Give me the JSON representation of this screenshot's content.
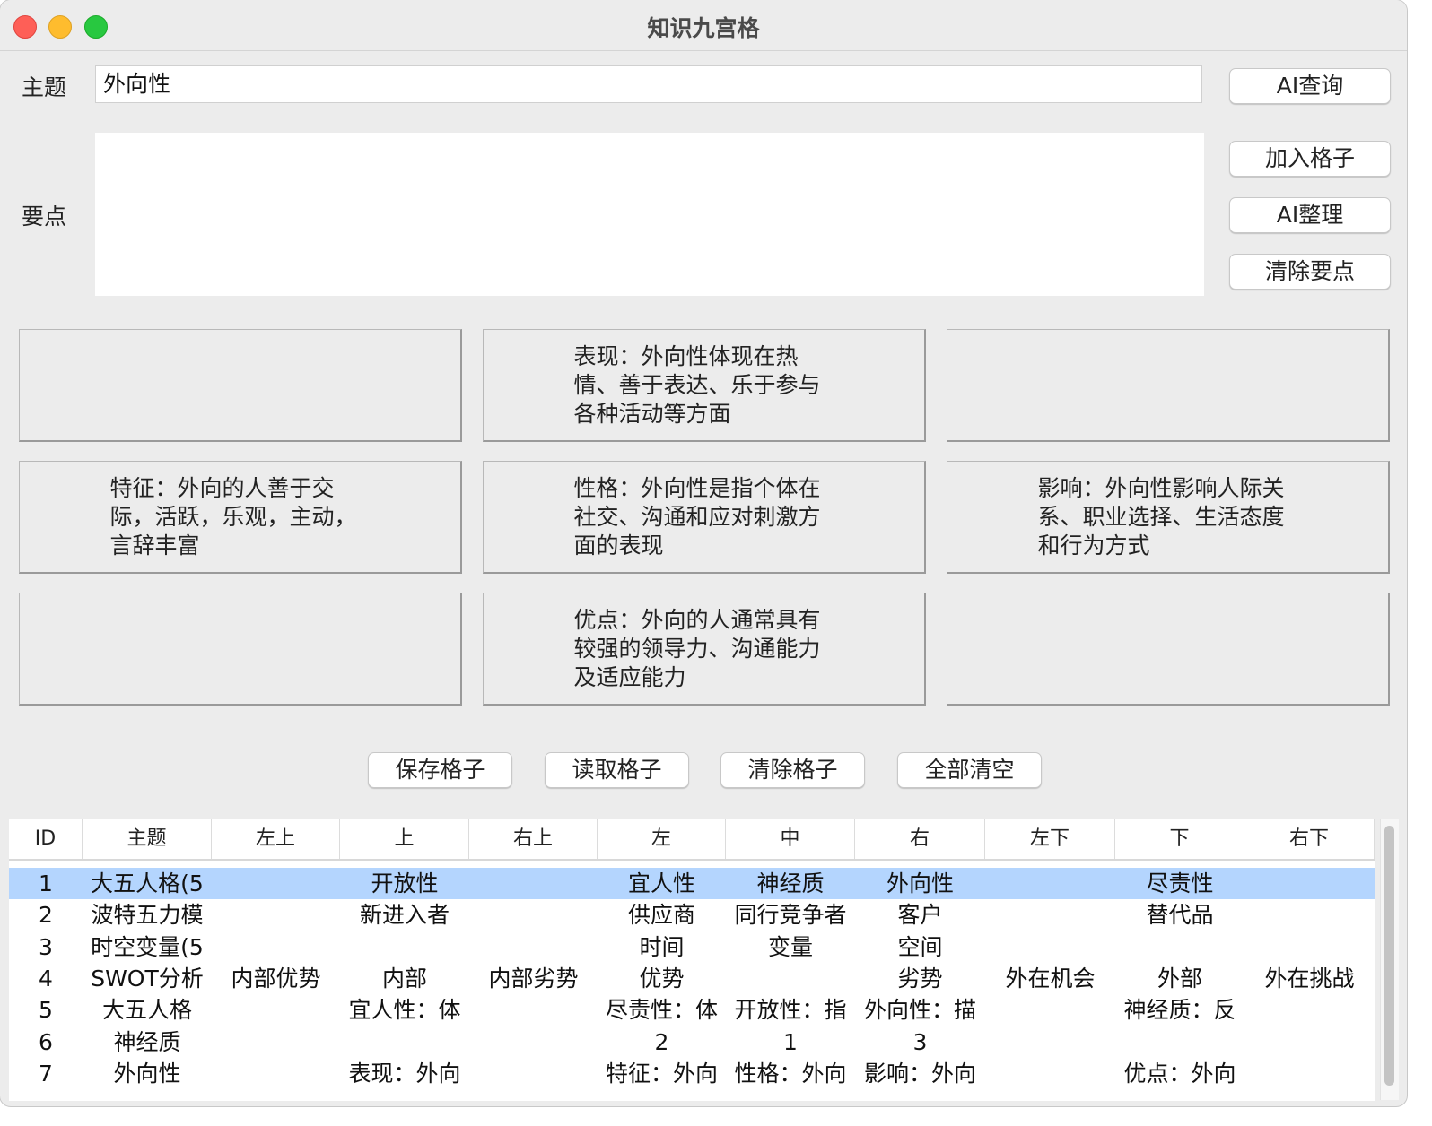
{
  "window": {
    "title": "知识九宫格"
  },
  "form": {
    "topic_label": "主题",
    "topic_value": "外向性",
    "points_label": "要点",
    "points_value": ""
  },
  "side_buttons": {
    "ai_query": "AI查询",
    "add_cell": "加入格子",
    "ai_organize": "AI整理",
    "clear_points": "清除要点"
  },
  "grid": {
    "top_left": "",
    "top": "表现：外向性体现在热情、善于表达、乐于参与各种活动等方面",
    "top_right": "",
    "left": "特征：外向的人善于交际，活跃，乐观，主动，言辞丰富",
    "center": "性格：外向性是指个体在社交、沟通和应对刺激方面的表现",
    "right": "影响：外向性影响人际关系、职业选择、生活态度和行为方式",
    "bottom_left": "",
    "bottom": "优点：外向的人通常具有较强的领导力、沟通能力及适应能力",
    "bottom_right": ""
  },
  "actions": {
    "save": "保存格子",
    "load": "读取格子",
    "clear": "清除格子",
    "clear_all": "全部清空"
  },
  "table": {
    "headers": [
      "ID",
      "主题",
      "左上",
      "上",
      "右上",
      "左",
      "中",
      "右",
      "左下",
      "下",
      "右下"
    ],
    "rows": [
      [
        "1",
        "大五人格(5",
        "",
        "开放性",
        "",
        "宜人性",
        "神经质",
        "外向性",
        "",
        "尽责性",
        ""
      ],
      [
        "2",
        "波特五力模",
        "",
        "新进入者",
        "",
        "供应商",
        "同行竞争者",
        "客户",
        "",
        "替代品",
        ""
      ],
      [
        "3",
        "时空变量(5",
        "",
        "",
        "",
        "时间",
        "变量",
        "空间",
        "",
        "",
        ""
      ],
      [
        "4",
        "SWOT分析",
        "内部优势",
        "内部",
        "内部劣势",
        "优势",
        "",
        "劣势",
        "外在机会",
        "外部",
        "外在挑战"
      ],
      [
        "5",
        "大五人格",
        "",
        "宜人性：体",
        "",
        "尽责性：体",
        "开放性：指",
        "外向性：描",
        "",
        "神经质：反",
        ""
      ],
      [
        "6",
        "神经质",
        "",
        "",
        "",
        "2",
        "1",
        "3",
        "",
        "",
        ""
      ],
      [
        "7",
        "外向性",
        "",
        "表现：外向",
        "",
        "特征：外向",
        "性格：外向",
        "影响：外向",
        "",
        "优点：外向",
        ""
      ]
    ],
    "selected_row": 0
  }
}
